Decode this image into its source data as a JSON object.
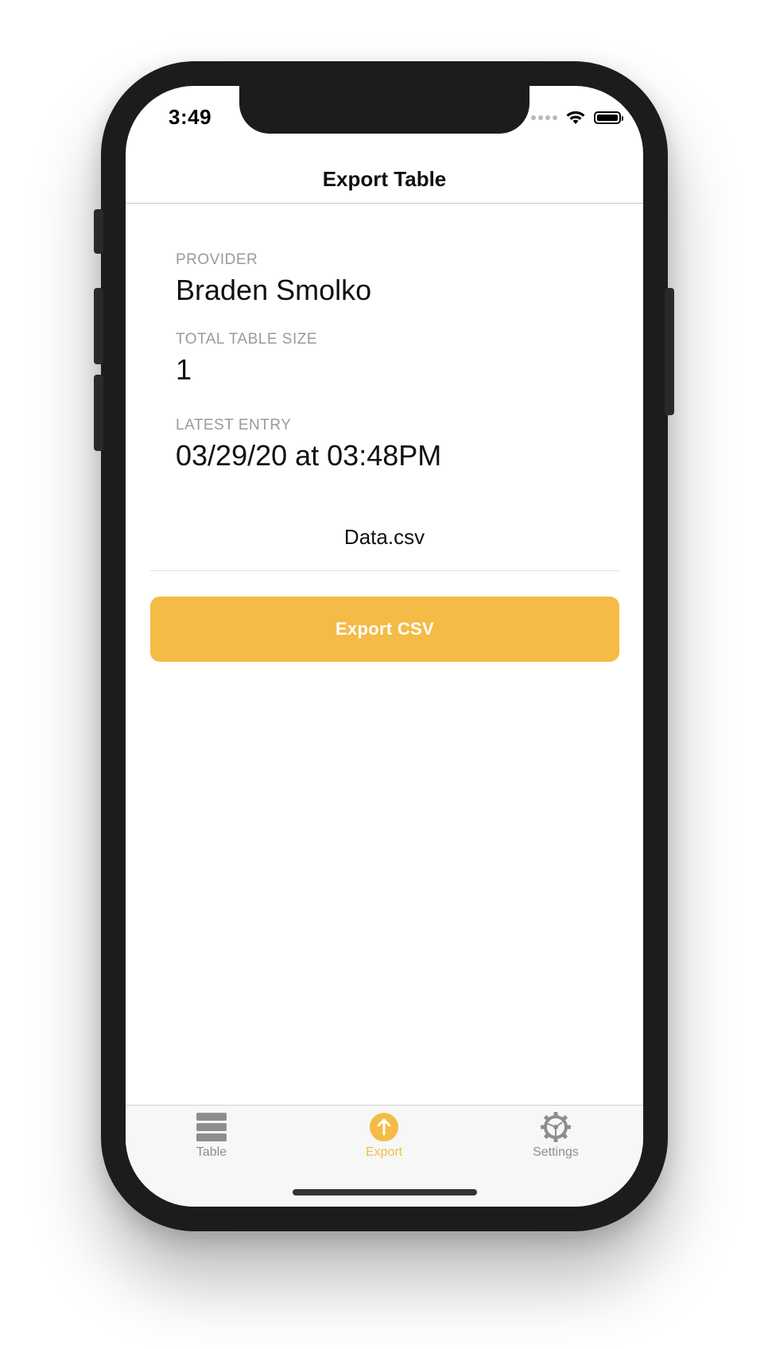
{
  "status_bar": {
    "time": "3:49"
  },
  "nav": {
    "title": "Export Table"
  },
  "details": {
    "provider_label": "PROVIDER",
    "provider_value": "Braden Smolko",
    "size_label": "TOTAL TABLE SIZE",
    "size_value": "1",
    "latest_label": "LATEST ENTRY",
    "latest_value": "03/29/20 at 03:48PM"
  },
  "file": {
    "name": "Data.csv"
  },
  "actions": {
    "export_label": "Export CSV"
  },
  "tab_bar": {
    "items": [
      {
        "label": "Table",
        "icon": "table-icon",
        "active": false
      },
      {
        "label": "Export",
        "icon": "export-icon",
        "active": true
      },
      {
        "label": "Settings",
        "icon": "gear-icon",
        "active": false
      }
    ]
  },
  "colors": {
    "accent": "#f4bb47",
    "inactive_tab": "#8e8e8e",
    "label_gray": "#9a9a9a"
  }
}
